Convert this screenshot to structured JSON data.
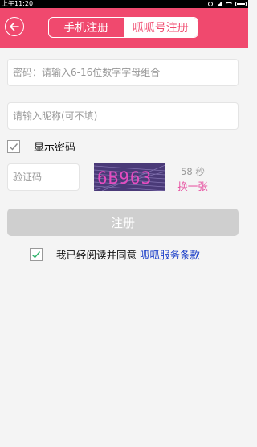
{
  "status_bar": {
    "time": "上午11:20",
    "icons": [
      "alarm-icon",
      "signal-icon",
      "wifi-icon",
      "battery-icon"
    ]
  },
  "header": {
    "back_icon": "back-arrow-icon",
    "tabs": [
      {
        "label": "手机注册",
        "active": false
      },
      {
        "label": "呱呱号注册",
        "active": true
      }
    ],
    "accent_color": "#f0496e"
  },
  "form": {
    "password_placeholder": "密码：请输入6-16位数字字母组合",
    "nickname_placeholder": "请输入昵称(可不填)",
    "show_password_label": "显示密码",
    "show_password_checked": true,
    "captcha_placeholder": "验证码",
    "captcha_text": "6B963",
    "countdown": "58 秒",
    "refresh_label": "换一张",
    "submit_label": "注册"
  },
  "agreement": {
    "checked": true,
    "text": "我已经阅读并同意",
    "link": "呱呱服务条款",
    "check_color": "#2db36a"
  }
}
